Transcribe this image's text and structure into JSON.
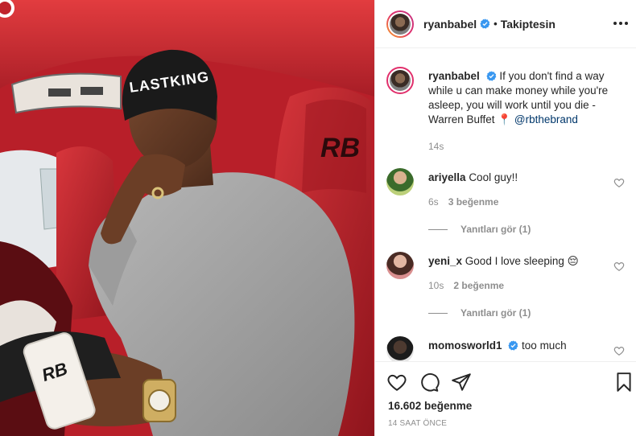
{
  "post": {
    "author": "ryanbabel",
    "follow_status": "Takiptesin",
    "dot": "•",
    "caption_text": "If you don't find a way while u can make money while you're asleep, you will work until you die - Warren Buffet 📍",
    "caption_mention": "@rbthebrand",
    "caption_age": "14s",
    "photo_texts": {
      "beanie": "LASTKING",
      "seat_logo": "RB",
      "phone_logo": "RB"
    }
  },
  "comments": [
    {
      "username": "ariyella",
      "text": "Cool guy!!",
      "age": "6s",
      "likes": "3 beğenme",
      "replies": "Yanıtları gör (1)"
    },
    {
      "username": "yeni_x",
      "text": "Good I love sleeping 😔",
      "age": "10s",
      "likes": "2 beğenme",
      "replies": "Yanıtları gör (1)"
    },
    {
      "username": "momosworld1",
      "text": "too much",
      "verified": true
    }
  ],
  "footer": {
    "likes": "16.602 beğenme",
    "time_ago": "14 SAAT ÖNCE"
  },
  "icons": {
    "more": "more-options-icon",
    "like": "heart-icon",
    "comment": "comment-icon",
    "share": "share-icon",
    "save": "bookmark-icon",
    "verified": "verified-badge-icon"
  },
  "colors": {
    "verified": "#3897f0",
    "text": "#262626",
    "muted": "#8e8e8e",
    "mention": "#00376b",
    "car_red": "#c0242d"
  }
}
